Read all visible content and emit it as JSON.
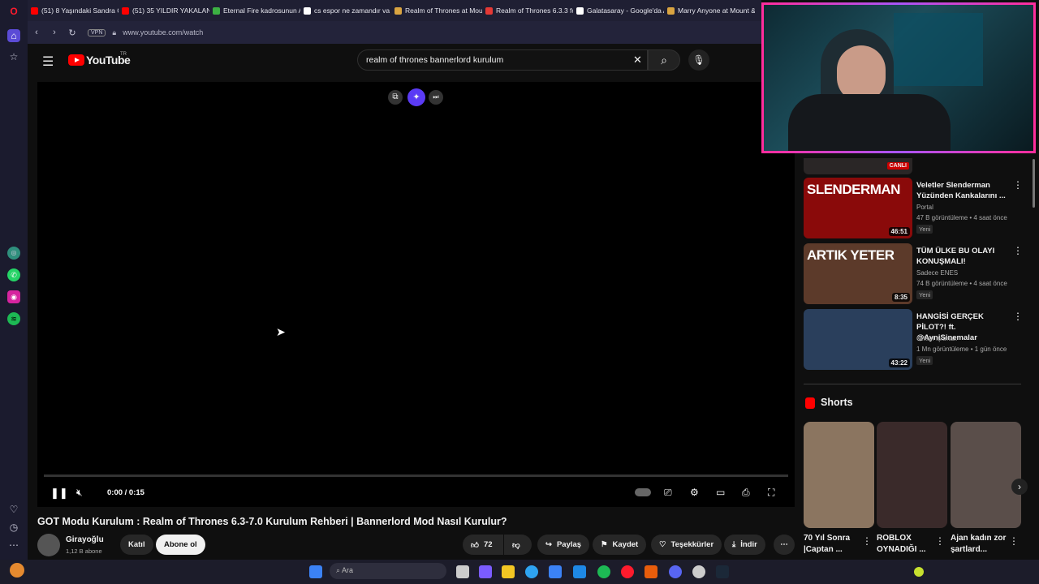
{
  "browser": {
    "tabs": [
      {
        "label": "(51) 8 Yaşındaki Sandra Ca",
        "color": "#ff0000"
      },
      {
        "label": "(51) 35 YILDIR YAKALANA",
        "color": "#ff0000"
      },
      {
        "label": "Eternal Fire kadrosunun A",
        "color": "#3cb043"
      },
      {
        "label": "cs espor ne zamandır va -",
        "color": "#ffffff"
      },
      {
        "label": "Realm of Thrones at Moun",
        "color": "#d9a441"
      },
      {
        "label": "Realm of Thrones 6.3.3 fo",
        "color": "#e53935"
      },
      {
        "label": "Galatasaray - Google'da A",
        "color": "#ffffff"
      },
      {
        "label": "Marry Anyone at Mount &",
        "color": "#d9a441"
      }
    ],
    "url": "www.youtube.com/watch",
    "vpn_label": "VPN"
  },
  "youtube": {
    "logo_text": "YouTube",
    "region": "TR",
    "search_query": "realm of thrones bannerlord kurulum"
  },
  "player": {
    "time": "0:00 / 0:15",
    "progress": 0
  },
  "video": {
    "title": "GOT Modu Kurulum : Realm of Thrones 6.3-7.0 Kurulum Rehberi | Bannerlord Mod Nasıl Kurulur?",
    "channel": "Girayoğlu",
    "subscribers": "1,12 B abone",
    "join_label": "Katıl",
    "subscribe_label": "Abone ol",
    "likes": "72",
    "share_label": "Paylaş",
    "save_label": "Kaydet",
    "thanks_label": "Teşekkürler",
    "download_label": "İndir"
  },
  "sidebar": {
    "live_badge": "CANLI",
    "recommendations": [
      {
        "title": "Veletler Slenderman Yüzünden Kankalarını ...",
        "channel": "Portal",
        "meta": "47 B görüntüleme • 4 saat önce",
        "badge": "Yeni",
        "duration": "46:51",
        "thumb_text": "SLENDERMAN"
      },
      {
        "title": "TÜM ÜLKE BU OLAYI KONUŞMALI!",
        "channel": "Sadece ENES",
        "meta": "74 B görüntüleme • 4 saat önce",
        "badge": "Yeni",
        "duration": "8:35",
        "thumb_text": "ARTIK YETER"
      },
      {
        "title": "HANGİSİ GERÇEK PİLOT?! ft. @AyniSinemalar",
        "channel": "Orkun Işıtmak",
        "meta": "1 Mn görüntüleme • 1 gün önce",
        "badge": "Yeni",
        "duration": "43:22",
        "thumb_text": ""
      }
    ],
    "shorts_heading": "Shorts",
    "shorts": [
      {
        "title": "70 Yıl Sonra |Captan ..."
      },
      {
        "title": "ROBLOX OYNADIĞI ..."
      },
      {
        "title": "Ajan kadın zor şartlard..."
      }
    ]
  },
  "taskbar": {
    "search_placeholder": "Ara"
  }
}
